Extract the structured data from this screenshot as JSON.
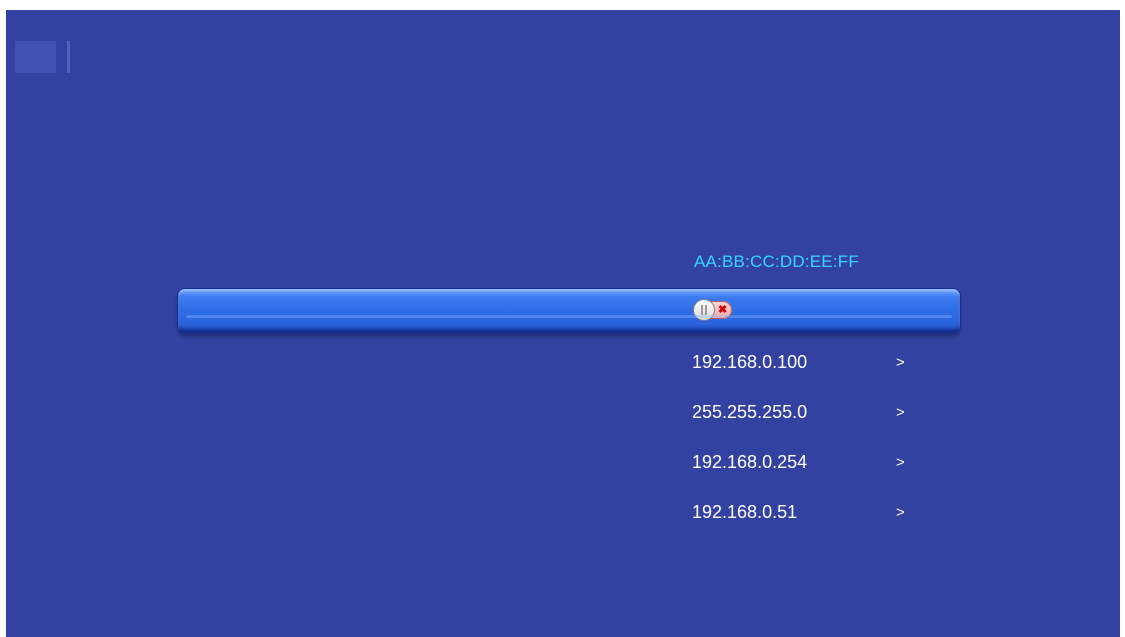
{
  "mac_address": "AA:BB:CC:DD:EE:FF",
  "toggle": {
    "state": "off",
    "off_symbol": "✖",
    "icon": "toggle-switch-icon"
  },
  "network_rows": [
    {
      "value": "192.168.0.100",
      "arrow": ">"
    },
    {
      "value": "255.255.255.0",
      "arrow": ">"
    },
    {
      "value": "192.168.0.254",
      "arrow": ">"
    },
    {
      "value": "192.168.0.51",
      "arrow": ">"
    }
  ],
  "colors": {
    "background": "#3342a1",
    "mac_text": "#37d6ff",
    "focus_bar": "#2f6de7",
    "text": "#ffffff"
  }
}
